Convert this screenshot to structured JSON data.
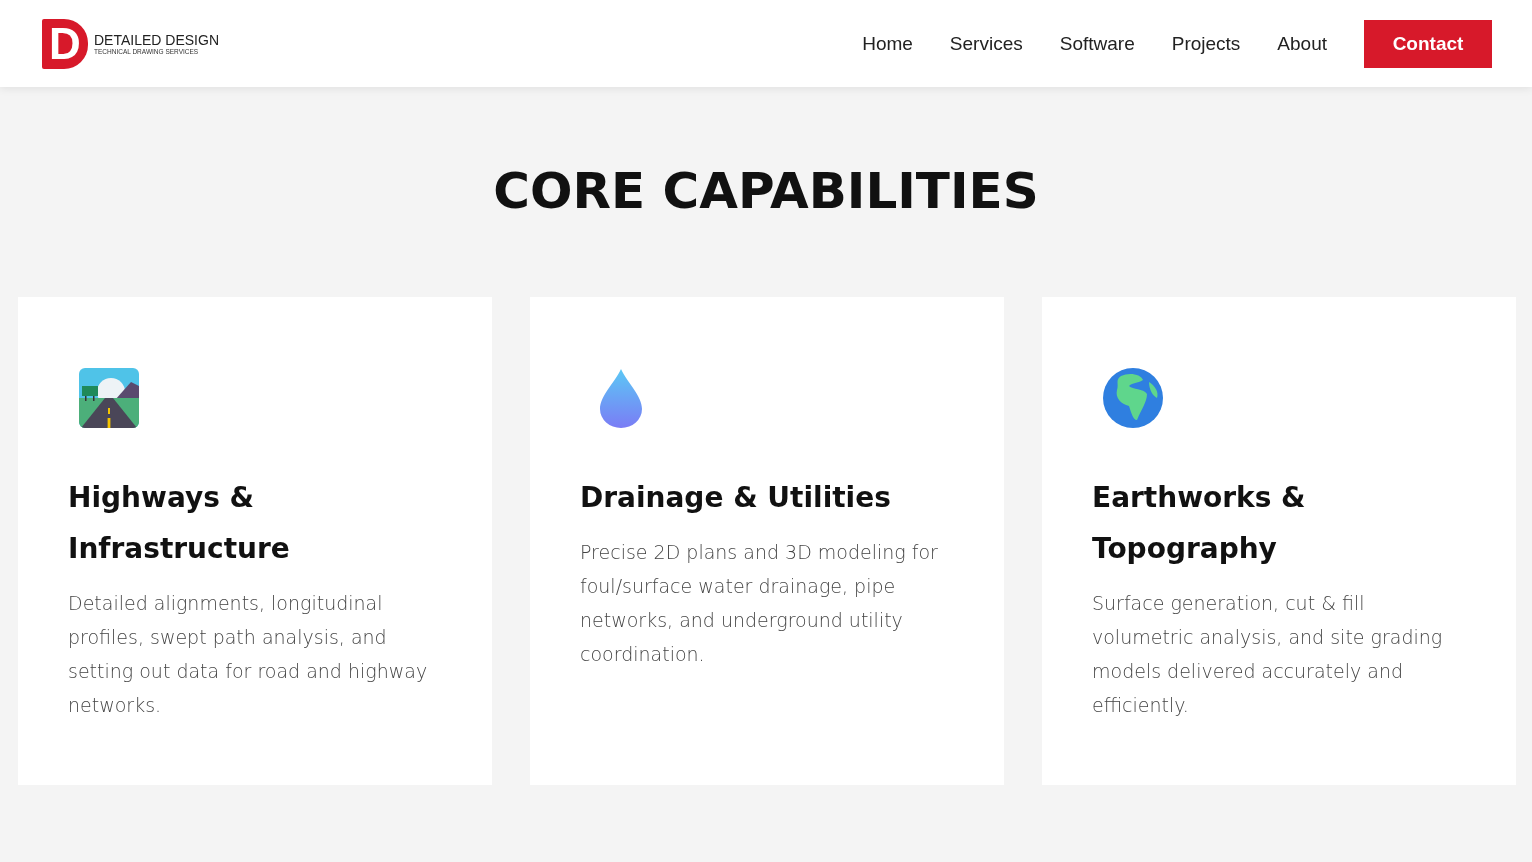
{
  "logo": {
    "mark": "D",
    "name": "DETAILED DESIGN",
    "tagline": "TECHNICAL DRAWING SERVICES"
  },
  "nav": [
    {
      "label": "Home"
    },
    {
      "label": "Services"
    },
    {
      "label": "Software"
    },
    {
      "label": "Projects"
    },
    {
      "label": "About"
    }
  ],
  "contact_button": "Contact",
  "heading": "CORE CAPABILITIES",
  "cards": [
    {
      "kind": "road",
      "title": "Highways & Infrastructure",
      "text": "Detailed alignments, longitudinal profiles, swept path analysis, and setting out data for road and highway networks."
    },
    {
      "kind": "drop",
      "title": "Drainage & Utilities",
      "text": "Precise 2D plans and 3D modeling for foul/surface water drainage, pipe networks, and underground utility coordination."
    },
    {
      "kind": "globe",
      "title": "Earthworks & Topography",
      "text": "Surface generation, cut & fill volumetric analysis, and site grading models delivered accurately and efficiently."
    }
  ]
}
